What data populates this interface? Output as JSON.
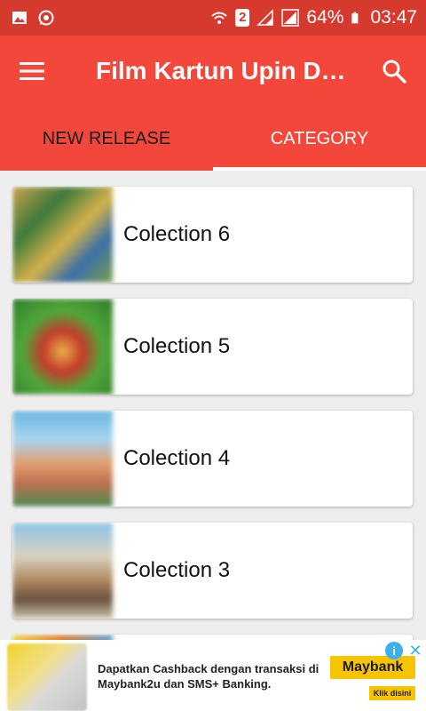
{
  "status_bar": {
    "battery": "64%",
    "time": "03:47",
    "sim_slot": "2",
    "icons": [
      "gallery-icon",
      "whatsapp-icon",
      "wifi-icon",
      "signal-icon",
      "battery-icon"
    ]
  },
  "app_bar": {
    "title": "Film Kartun Upin D…",
    "icons": [
      "menu-icon",
      "search-icon"
    ]
  },
  "tabs": [
    {
      "label": "NEW RELEASE",
      "active": true
    },
    {
      "label": "CATEGORY",
      "active": false
    }
  ],
  "list": {
    "items": [
      {
        "label": "Colection 6"
      },
      {
        "label": "Colection 5"
      },
      {
        "label": "Colection 4"
      },
      {
        "label": "Colection 3"
      }
    ]
  },
  "ad": {
    "text": "Dapatkan Cashback dengan transaksi di Maybank2u dan SMS+ Banking.",
    "brand": "Maybank",
    "cta": "Klik disini",
    "info": "i",
    "close": "✕"
  },
  "colors": {
    "status_bar": "#d63a2f",
    "app_bar": "#f2473a",
    "background": "#eeeeee"
  }
}
